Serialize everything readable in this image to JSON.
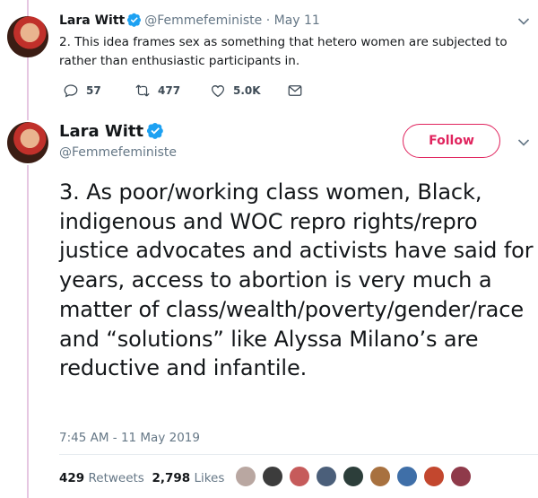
{
  "tweet1": {
    "author_name": "Lara Witt",
    "handle": "@Femmefeministe",
    "separator": "·",
    "date": "May 11",
    "text": "2. This idea frames sex as something that hetero women are subjected to rather than enthusiastic participants in.",
    "reply_count": "57",
    "retweet_count": "477",
    "like_count": "5.0K"
  },
  "tweet2": {
    "author_name": "Lara Witt",
    "handle": "@Femmefeministe",
    "follow_label": "Follow",
    "text": "3. As poor/working class women, Black, indigenous and WOC repro rights/repro justice advocates and activists have said for years, access to abortion is very much a matter of class/wealth/poverty/gender/race and “solutions” like Alyssa Milano’s are reductive and infantile.",
    "timestamp": "7:45 AM - 11 May 2019",
    "retweets_count": "429",
    "retweets_label": "Retweets",
    "likes_count": "2,798",
    "likes_label": "Likes"
  },
  "colors": {
    "thread_line": "#e6c7e2",
    "follow_accent": "#e0245e",
    "verified_blue": "#1da1f2",
    "muted_text": "#657786"
  },
  "icons": [
    "verified-badge-icon",
    "chevron-down-icon",
    "reply-icon",
    "retweet-icon",
    "like-icon",
    "direct-message-icon"
  ]
}
